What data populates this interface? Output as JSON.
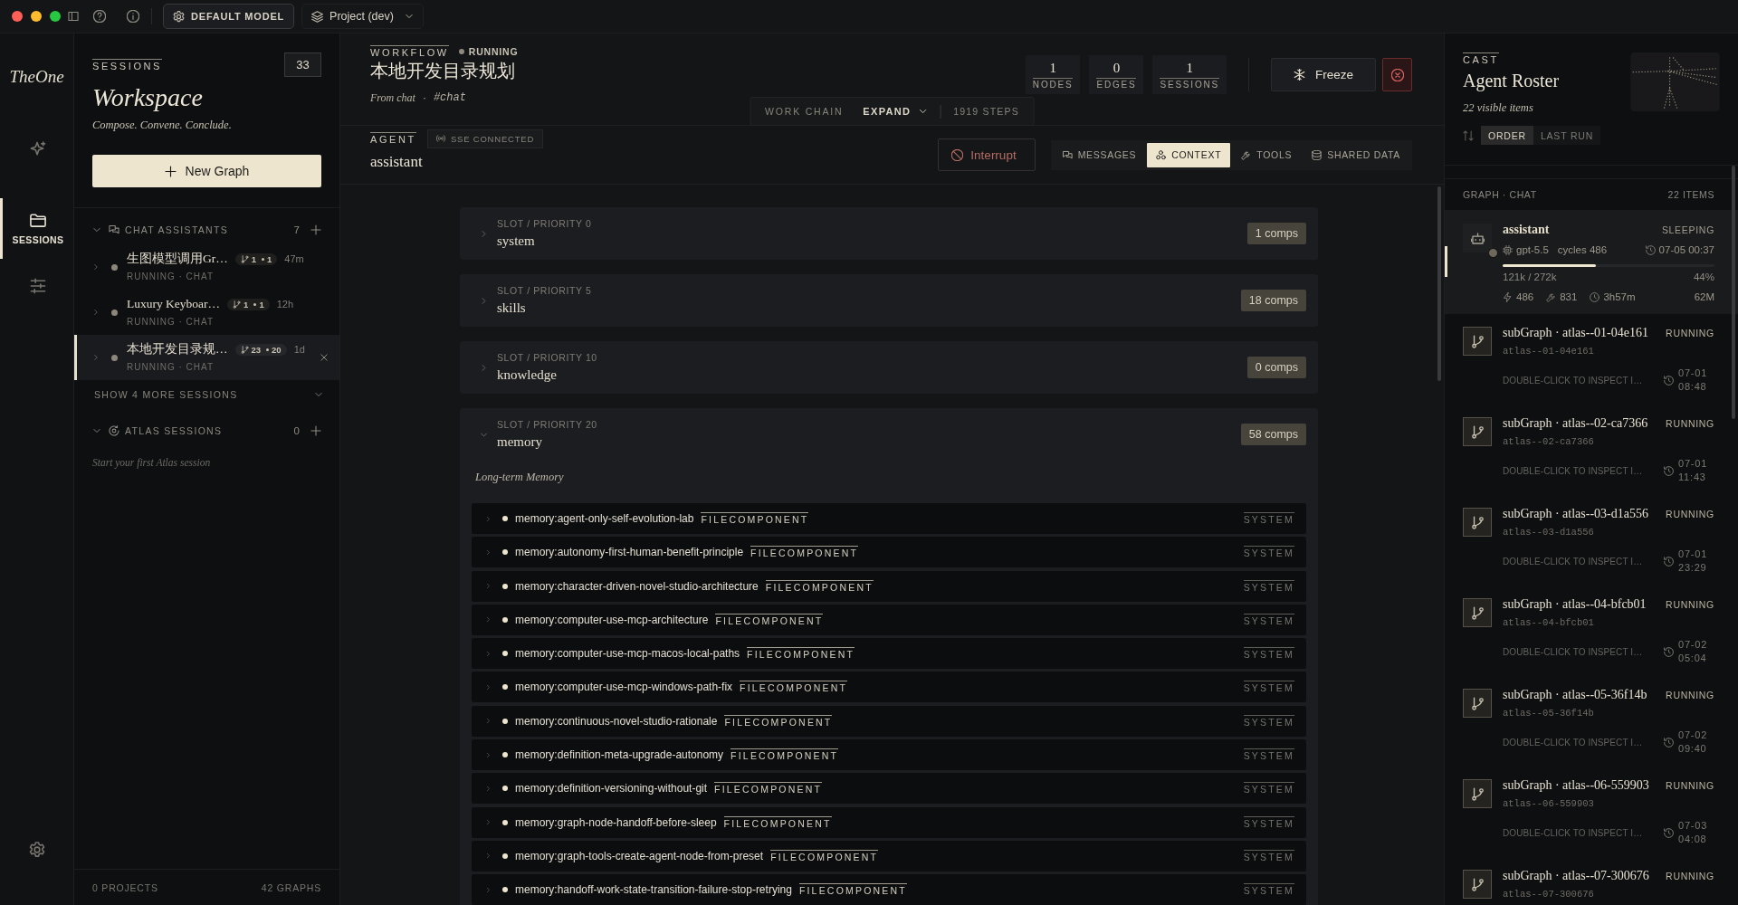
{
  "toolbar": {
    "model_button": "DEFAULT MODEL",
    "project": "Project (dev)"
  },
  "rail": {
    "logo": "TheOne",
    "items": [
      {
        "kind": "sparkle",
        "selected": false
      },
      {
        "kind": "folder",
        "label": "SESSIONS",
        "selected": true
      },
      {
        "kind": "sliders",
        "selected": false
      }
    ]
  },
  "sessions_panel": {
    "label": "SESSIONS",
    "count": "33",
    "title": "Workspace",
    "tagline": "Compose. Convene. Conclude.",
    "new_button": "New Graph",
    "groups": [
      {
        "kind": "chat",
        "label": "CHAT ASSISTANTS",
        "count": "7",
        "expanded": true,
        "sessions": [
          {
            "title": "生图模型调用Gr…",
            "branches": "1",
            "nodes": "1",
            "age": "47m",
            "status": "RUNNING · CHAT",
            "selected": false
          },
          {
            "title": "Luxury Keyboar…",
            "branches": "1",
            "nodes": "1",
            "age": "12h",
            "status": "RUNNING · CHAT",
            "selected": false
          },
          {
            "title": "本地开发目录规…",
            "branches": "23",
            "nodes": "20",
            "age": "1d",
            "status": "RUNNING · CHAT",
            "selected": true
          }
        ],
        "more": "SHOW 4 MORE SESSIONS"
      },
      {
        "kind": "atlas",
        "label": "ATLAS SESSIONS",
        "count": "0",
        "expanded": true,
        "empty_hint": "Start your first Atlas session"
      }
    ],
    "footer": {
      "projects": "0 PROJECTS",
      "graphs": "42 GRAPHS"
    }
  },
  "workflow": {
    "label": "WORKFLOW",
    "status": "RUNNING",
    "title": "本地开发目录规划",
    "source": "From chat",
    "separator": "·",
    "channel": "#chat",
    "stats": [
      {
        "value": "1",
        "label": "NODES"
      },
      {
        "value": "0",
        "label": "EDGES"
      },
      {
        "value": "1",
        "label": "SESSIONS"
      }
    ],
    "freeze_button": "Freeze",
    "work_chain": {
      "label": "WORK CHAIN",
      "expand": "EXPAND",
      "steps": "1919 STEPS"
    }
  },
  "agent": {
    "label": "AGENT",
    "connection": "SSE CONNECTED",
    "name": "assistant",
    "interrupt_button": "Interrupt",
    "tabs": [
      {
        "kind": "messages",
        "label": "MESSAGES",
        "selected": false
      },
      {
        "kind": "context",
        "label": "CONTEXT",
        "selected": true
      },
      {
        "kind": "tools",
        "label": "TOOLS",
        "selected": false
      },
      {
        "kind": "shared_data",
        "label": "SHARED DATA",
        "selected": false
      }
    ]
  },
  "slots": [
    {
      "priority": "SLOT / PRIORITY 0",
      "name": "system",
      "comps": "1 comps",
      "expanded": false
    },
    {
      "priority": "SLOT / PRIORITY 5",
      "name": "skills",
      "comps": "18 comps",
      "expanded": false
    },
    {
      "priority": "SLOT / PRIORITY 10",
      "name": "knowledge",
      "comps": "0 comps",
      "expanded": false
    },
    {
      "priority": "SLOT / PRIORITY 20",
      "name": "memory",
      "comps": "58 comps",
      "expanded": true,
      "section": "Long-term Memory",
      "items": [
        {
          "name": "memory:agent-only-self-evolution-lab",
          "type": "FILECOMPONENT",
          "scope": "SYSTEM"
        },
        {
          "name": "memory:autonomy-first-human-benefit-principle",
          "type": "FILECOMPONENT",
          "scope": "SYSTEM"
        },
        {
          "name": "memory:character-driven-novel-studio-architecture",
          "type": "FILECOMPONENT",
          "scope": "SYSTEM"
        },
        {
          "name": "memory:computer-use-mcp-architecture",
          "type": "FILECOMPONENT",
          "scope": "SYSTEM"
        },
        {
          "name": "memory:computer-use-mcp-macos-local-paths",
          "type": "FILECOMPONENT",
          "scope": "SYSTEM"
        },
        {
          "name": "memory:computer-use-mcp-windows-path-fix",
          "type": "FILECOMPONENT",
          "scope": "SYSTEM"
        },
        {
          "name": "memory:continuous-novel-studio-rationale",
          "type": "FILECOMPONENT",
          "scope": "SYSTEM"
        },
        {
          "name": "memory:definition-meta-upgrade-autonomy",
          "type": "FILECOMPONENT",
          "scope": "SYSTEM"
        },
        {
          "name": "memory:definition-versioning-without-git",
          "type": "FILECOMPONENT",
          "scope": "SYSTEM"
        },
        {
          "name": "memory:graph-node-handoff-before-sleep",
          "type": "FILECOMPONENT",
          "scope": "SYSTEM"
        },
        {
          "name": "memory:graph-tools-create-agent-node-from-preset",
          "type": "FILECOMPONENT",
          "scope": "SYSTEM"
        },
        {
          "name": "memory:handoff-work-state-transition-failure-stop-retrying",
          "type": "FILECOMPONENT",
          "scope": "SYSTEM"
        }
      ]
    }
  ],
  "roster": {
    "label": "CAST",
    "title": "Agent Roster",
    "subtitle": "22 visible items",
    "sort": [
      {
        "label": "ORDER",
        "selected": true
      },
      {
        "label": "LAST RUN",
        "selected": false
      }
    ],
    "group": {
      "label": "GRAPH · CHAT",
      "count": "22 ITEMS"
    },
    "items": [
      {
        "kind": "agent",
        "name": "assistant",
        "status": "SLEEPING",
        "model": "gpt-5.5",
        "cycles": "cycles 486",
        "time": "07-05 00:37",
        "level": 0.44,
        "tokens": "121k / 272k",
        "percent": "44%",
        "runs": "486",
        "tools": "831",
        "duration": "3h57m",
        "size": "62M",
        "selected": true
      },
      {
        "kind": "subgraph",
        "name": "subGraph · atlas--01-04e161",
        "status": "RUNNING",
        "id": "atlas--01-04e161",
        "hint": "DOUBLE-CLICK TO INSPECT I…",
        "time": "07-01 08:48",
        "selected": false
      },
      {
        "kind": "subgraph",
        "name": "subGraph · atlas--02-ca7366",
        "status": "RUNNING",
        "id": "atlas--02-ca7366",
        "hint": "DOUBLE-CLICK TO INSPECT I…",
        "time": "07-01 11:43",
        "selected": false
      },
      {
        "kind": "subgraph",
        "name": "subGraph · atlas--03-d1a556",
        "status": "RUNNING",
        "id": "atlas--03-d1a556",
        "hint": "DOUBLE-CLICK TO INSPECT I…",
        "time": "07-01 23:29",
        "selected": false
      },
      {
        "kind": "subgraph",
        "name": "subGraph · atlas--04-bfcb01",
        "status": "RUNNING",
        "id": "atlas--04-bfcb01",
        "hint": "DOUBLE-CLICK TO INSPECT I…",
        "time": "07-02 05:04",
        "selected": false
      },
      {
        "kind": "subgraph",
        "name": "subGraph · atlas--05-36f14b",
        "status": "RUNNING",
        "id": "atlas--05-36f14b",
        "hint": "DOUBLE-CLICK TO INSPECT I…",
        "time": "07-02 09:40",
        "selected": false
      },
      {
        "kind": "subgraph",
        "name": "subGraph · atlas--06-559903",
        "status": "RUNNING",
        "id": "atlas--06-559903",
        "hint": "DOUBLE-CLICK TO INSPECT I…",
        "time": "07-03 04:08",
        "selected": false
      },
      {
        "kind": "subgraph",
        "name": "subGraph · atlas--07-300676",
        "status": "RUNNING",
        "id": "atlas--07-300676",
        "selected": false
      }
    ]
  }
}
